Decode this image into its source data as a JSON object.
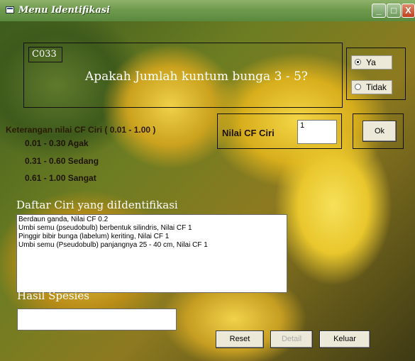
{
  "window": {
    "title": "Menu Identifikasi",
    "min_symbol": "_",
    "max_symbol": "□",
    "close_symbol": "X"
  },
  "question": {
    "code": "C033",
    "text": "Apakah Jumlah kuntum bunga 3 - 5?"
  },
  "answer_options": [
    {
      "label": "Ya",
      "selected": true
    },
    {
      "label": "Tidak",
      "selected": false
    }
  ],
  "legend": {
    "title": "Keterangan nilai CF Ciri ( 0.01 - 1.00 )",
    "lines": [
      "0.01 - 0.30  Agak",
      "0.31 - 0.60  Sedang",
      "0.61 - 1.00 Sangat"
    ]
  },
  "cf": {
    "label": "Nilai CF Ciri",
    "value": "1"
  },
  "buttons": {
    "ok": "Ok",
    "reset": "Reset",
    "detail": "Detail",
    "keluar": "Keluar"
  },
  "identified_list": {
    "title": "Daftar Ciri yang diIdentifikasi",
    "items": [
      "Berdaun ganda, Nilai CF 0.2",
      "Umbi semu (pseudobulb) berbentuk silindris, Nilai CF 1",
      "Pinggir bibir bunga (labelum) keriting, Nilai CF 1",
      "Umbi semu (Pseudobulb) panjangnya 25 - 40 cm, Nilai CF 1"
    ]
  },
  "result": {
    "title": "Hasil Spesies",
    "value": ""
  }
}
